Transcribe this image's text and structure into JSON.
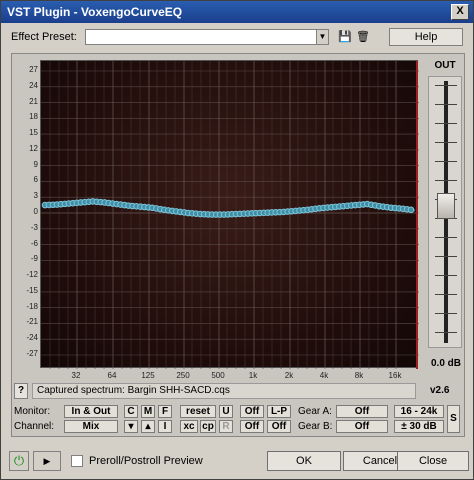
{
  "window": {
    "title": "VST Plugin - VoxengoCurveEQ",
    "close_glyph": "X"
  },
  "preset": {
    "label": "Effect Preset:",
    "value": "",
    "help": "Help",
    "icons": [
      "save-icon",
      "delete-icon"
    ]
  },
  "graph": {
    "y_ticks": [
      "27",
      "24",
      "21",
      "18",
      "15",
      "12",
      "9",
      "6",
      "3",
      "0",
      "-3",
      "-6",
      "-9",
      "-12",
      "-15",
      "-18",
      "-21",
      "-24",
      "-27"
    ],
    "x_ticks": [
      "32",
      "64",
      "125",
      "250",
      "500",
      "1k",
      "2k",
      "4k",
      "8k",
      "16k"
    ],
    "curve_db": [
      1.5,
      1.6,
      1.8,
      2.0,
      2.2,
      2.0,
      1.7,
      1.4,
      1.2,
      1.0,
      0.6,
      0.3,
      0.0,
      -0.2,
      -0.3,
      -0.3,
      -0.2,
      -0.1,
      0.0,
      0.1,
      0.2,
      0.4,
      0.6,
      0.9,
      1.1,
      1.3,
      1.5,
      1.7,
      1.3,
      1.0,
      0.8,
      0.5
    ]
  },
  "out": {
    "label": "OUT",
    "value": "0.0 dB"
  },
  "status": {
    "help_btn": "?",
    "text": "Captured spectrum: Bargin SHH-SACD.cqs",
    "version": "v2.6"
  },
  "controls": {
    "monitor_label": "Monitor:",
    "monitor_value": "In & Out",
    "channel_label": "Channel:",
    "channel_value": "Mix",
    "c": "C",
    "m": "M",
    "f": "F",
    "down": "▾",
    "up": "▴",
    "i": "I",
    "reset": "reset",
    "u": "U",
    "xc": "xc",
    "cp": "cp",
    "r": "R",
    "off1": "Off",
    "lp": "L-P",
    "off2": "Off",
    "off3": "Off",
    "gear_a_label": "Gear A:",
    "gear_a_value": "Off",
    "gear_b_label": "Gear B:",
    "gear_b_value": "Off",
    "range": "16 - 24k",
    "db_range": "± 30 dB",
    "s": "S"
  },
  "bottom": {
    "power_glyph": "⏻",
    "play_glyph": "▶",
    "preroll_label": "Preroll/Postroll Preview",
    "ok": "OK",
    "cancel": "Cancel",
    "close": "Close"
  },
  "colors": {
    "curve": "#7ec4d8",
    "graph_bg": "#2a1310",
    "title_bar": "#1a3f8c"
  }
}
